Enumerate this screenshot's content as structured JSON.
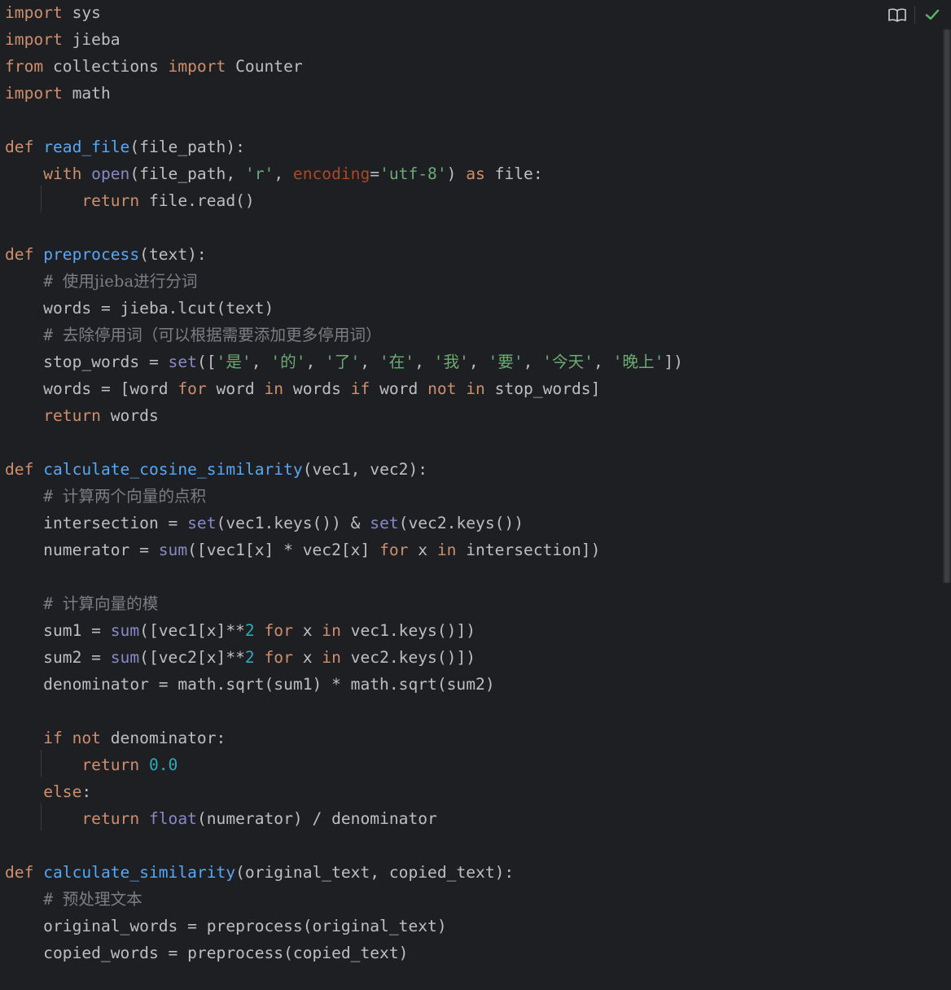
{
  "editor": {
    "language": "python",
    "toolbar": {
      "reader_mode_icon": "book-open-icon",
      "inspection_status_icon": "checkmark-icon",
      "check_color": "#5fb865"
    },
    "colors": {
      "background": "#1e1f22",
      "keyword": "#cf8e6d",
      "function": "#56a8f5",
      "builtin": "#8888c6",
      "string": "#6aab73",
      "comment": "#7a7e85",
      "number": "#2aacb8",
      "kwarg": "#aa4926",
      "text": "#bcbec4"
    },
    "lines": [
      [
        [
          "kw",
          "import"
        ],
        [
          "id",
          " sys"
        ]
      ],
      [
        [
          "kw",
          "import"
        ],
        [
          "id",
          " jieba"
        ]
      ],
      [
        [
          "kw",
          "from"
        ],
        [
          "id",
          " collections "
        ],
        [
          "kw",
          "import"
        ],
        [
          "id",
          " Counter"
        ]
      ],
      [
        [
          "kw",
          "import"
        ],
        [
          "id",
          " math"
        ]
      ],
      [],
      [
        [
          "kw",
          "def "
        ],
        [
          "fn",
          "read_file"
        ],
        [
          "id",
          "(file_path):"
        ]
      ],
      [
        [
          "id",
          "    "
        ],
        [
          "kw",
          "with "
        ],
        [
          "bi",
          "open"
        ],
        [
          "id",
          "(file_path, "
        ],
        [
          "str",
          "'r'"
        ],
        [
          "id",
          ", "
        ],
        [
          "kwarg",
          "encoding"
        ],
        [
          "id",
          "="
        ],
        [
          "str",
          "'utf-8'"
        ],
        [
          "id",
          ") "
        ],
        [
          "kw",
          "as"
        ],
        [
          "id",
          " file:"
        ]
      ],
      [
        [
          "id",
          "        "
        ],
        [
          "kw",
          "return"
        ],
        [
          "id",
          " file.read()"
        ]
      ],
      [],
      [
        [
          "kw",
          "def "
        ],
        [
          "fn",
          "preprocess"
        ],
        [
          "id",
          "(text):"
        ]
      ],
      [
        [
          "id",
          "    "
        ],
        [
          "cmt",
          "# "
        ],
        [
          "cmtcjk",
          "使用jieba进行分词"
        ]
      ],
      [
        [
          "id",
          "    words = jieba.lcut(text)"
        ]
      ],
      [
        [
          "id",
          "    "
        ],
        [
          "cmt",
          "# "
        ],
        [
          "cmtcjk",
          "去除停用词（可以根据需要添加更多停用词）"
        ]
      ],
      [
        [
          "id",
          "    stop_words = "
        ],
        [
          "bi",
          "set"
        ],
        [
          "id",
          "(["
        ],
        [
          "str",
          "'"
        ],
        [
          "strcjk",
          "是"
        ],
        [
          "str",
          "'"
        ],
        [
          "id",
          ", "
        ],
        [
          "str",
          "'"
        ],
        [
          "strcjk",
          "的"
        ],
        [
          "str",
          "'"
        ],
        [
          "id",
          ", "
        ],
        [
          "str",
          "'"
        ],
        [
          "strcjk",
          "了"
        ],
        [
          "str",
          "'"
        ],
        [
          "id",
          ", "
        ],
        [
          "str",
          "'"
        ],
        [
          "strcjk",
          "在"
        ],
        [
          "str",
          "'"
        ],
        [
          "id",
          ", "
        ],
        [
          "str",
          "'"
        ],
        [
          "strcjk",
          "我"
        ],
        [
          "str",
          "'"
        ],
        [
          "id",
          ", "
        ],
        [
          "str",
          "'"
        ],
        [
          "strcjk",
          "要"
        ],
        [
          "str",
          "'"
        ],
        [
          "id",
          ", "
        ],
        [
          "str",
          "'"
        ],
        [
          "strcjk",
          "今天"
        ],
        [
          "str",
          "'"
        ],
        [
          "id",
          ", "
        ],
        [
          "str",
          "'"
        ],
        [
          "strcjk",
          "晚上"
        ],
        [
          "str",
          "'"
        ],
        [
          "id",
          "])"
        ]
      ],
      [
        [
          "id",
          "    words = [word "
        ],
        [
          "kw",
          "for"
        ],
        [
          "id",
          " word "
        ],
        [
          "kw",
          "in"
        ],
        [
          "id",
          " words "
        ],
        [
          "kw",
          "if"
        ],
        [
          "id",
          " word "
        ],
        [
          "kw",
          "not in"
        ],
        [
          "id",
          " stop_words]"
        ]
      ],
      [
        [
          "id",
          "    "
        ],
        [
          "kw",
          "return"
        ],
        [
          "id",
          " words"
        ]
      ],
      [],
      [
        [
          "kw",
          "def "
        ],
        [
          "fn",
          "calculate_cosine_similarity"
        ],
        [
          "id",
          "(vec1, vec2):"
        ]
      ],
      [
        [
          "id",
          "    "
        ],
        [
          "cmt",
          "# "
        ],
        [
          "cmtcjk",
          "计算两个向量的点积"
        ]
      ],
      [
        [
          "id",
          "    intersection = "
        ],
        [
          "bi",
          "set"
        ],
        [
          "id",
          "(vec1.keys()) & "
        ],
        [
          "bi",
          "set"
        ],
        [
          "id",
          "(vec2.keys())"
        ]
      ],
      [
        [
          "id",
          "    numerator = "
        ],
        [
          "bi",
          "sum"
        ],
        [
          "id",
          "([vec1[x] * vec2[x] "
        ],
        [
          "kw",
          "for"
        ],
        [
          "id",
          " x "
        ],
        [
          "kw",
          "in"
        ],
        [
          "id",
          " intersection])"
        ]
      ],
      [],
      [
        [
          "id",
          "    "
        ],
        [
          "cmt",
          "# "
        ],
        [
          "cmtcjk",
          "计算向量的模"
        ]
      ],
      [
        [
          "id",
          "    sum1 = "
        ],
        [
          "bi",
          "sum"
        ],
        [
          "id",
          "([vec1[x]**"
        ],
        [
          "num",
          "2"
        ],
        [
          "id",
          " "
        ],
        [
          "kw",
          "for"
        ],
        [
          "id",
          " x "
        ],
        [
          "kw",
          "in"
        ],
        [
          "id",
          " vec1.keys()])"
        ]
      ],
      [
        [
          "id",
          "    sum2 = "
        ],
        [
          "bi",
          "sum"
        ],
        [
          "id",
          "([vec2[x]**"
        ],
        [
          "num",
          "2"
        ],
        [
          "id",
          " "
        ],
        [
          "kw",
          "for"
        ],
        [
          "id",
          " x "
        ],
        [
          "kw",
          "in"
        ],
        [
          "id",
          " vec2.keys()])"
        ]
      ],
      [
        [
          "id",
          "    denominator = math.sqrt(sum1) * math.sqrt(sum2)"
        ]
      ],
      [],
      [
        [
          "id",
          "    "
        ],
        [
          "kw",
          "if not"
        ],
        [
          "id",
          " denominator:"
        ]
      ],
      [
        [
          "id",
          "        "
        ],
        [
          "kw",
          "return "
        ],
        [
          "num",
          "0.0"
        ]
      ],
      [
        [
          "id",
          "    "
        ],
        [
          "kw",
          "else"
        ],
        [
          "id",
          ":"
        ]
      ],
      [
        [
          "id",
          "        "
        ],
        [
          "kw",
          "return "
        ],
        [
          "bi",
          "float"
        ],
        [
          "id",
          "(numerator) / denominator"
        ]
      ],
      [],
      [
        [
          "kw",
          "def "
        ],
        [
          "fn",
          "calculate_similarity"
        ],
        [
          "id",
          "(original_text, copied_text):"
        ]
      ],
      [
        [
          "id",
          "    "
        ],
        [
          "cmt",
          "# "
        ],
        [
          "cmtcjk",
          "预处理文本"
        ]
      ],
      [
        [
          "id",
          "    original_words = preprocess(original_text)"
        ]
      ],
      [
        [
          "id",
          "    copied_words = preprocess(copied_text)"
        ]
      ],
      []
    ]
  }
}
